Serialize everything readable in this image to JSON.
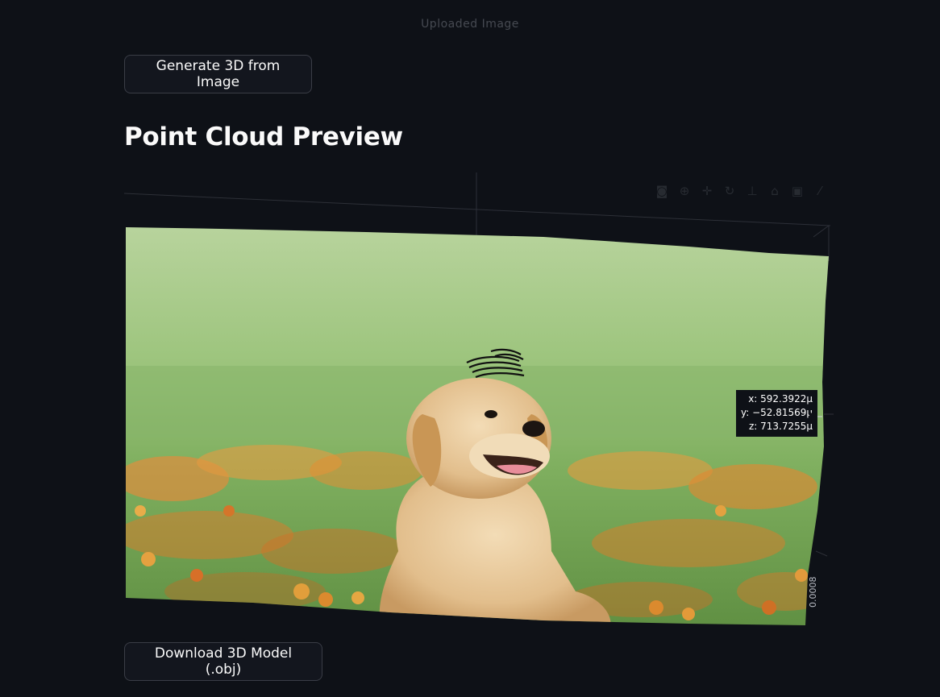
{
  "top_caption": "Uploaded Image",
  "buttons": {
    "generate_label": "Generate 3D from Image",
    "download_label": "Download 3D Model (.obj)"
  },
  "section": {
    "title": "Point Cloud Preview"
  },
  "plot": {
    "hover": {
      "x_text": "x: 592.3922µ",
      "y_text": "y: −52.81569µ",
      "z_text": "z: 713.7255µ"
    },
    "axis_tick_label": "0.0008",
    "modebar_icons": [
      "camera-icon",
      "zoom-icon",
      "pan-icon",
      "orbit-icon",
      "turntable-icon",
      "reset-camera-icon",
      "home-icon",
      "plotly-logo-icon"
    ],
    "colors": {
      "background": "#0e1117",
      "grass_light": "#a9c98a",
      "grass_mid": "#7fb062",
      "flower_orange": "#f08a2c",
      "puppy_fur": "#e6c79a"
    }
  }
}
